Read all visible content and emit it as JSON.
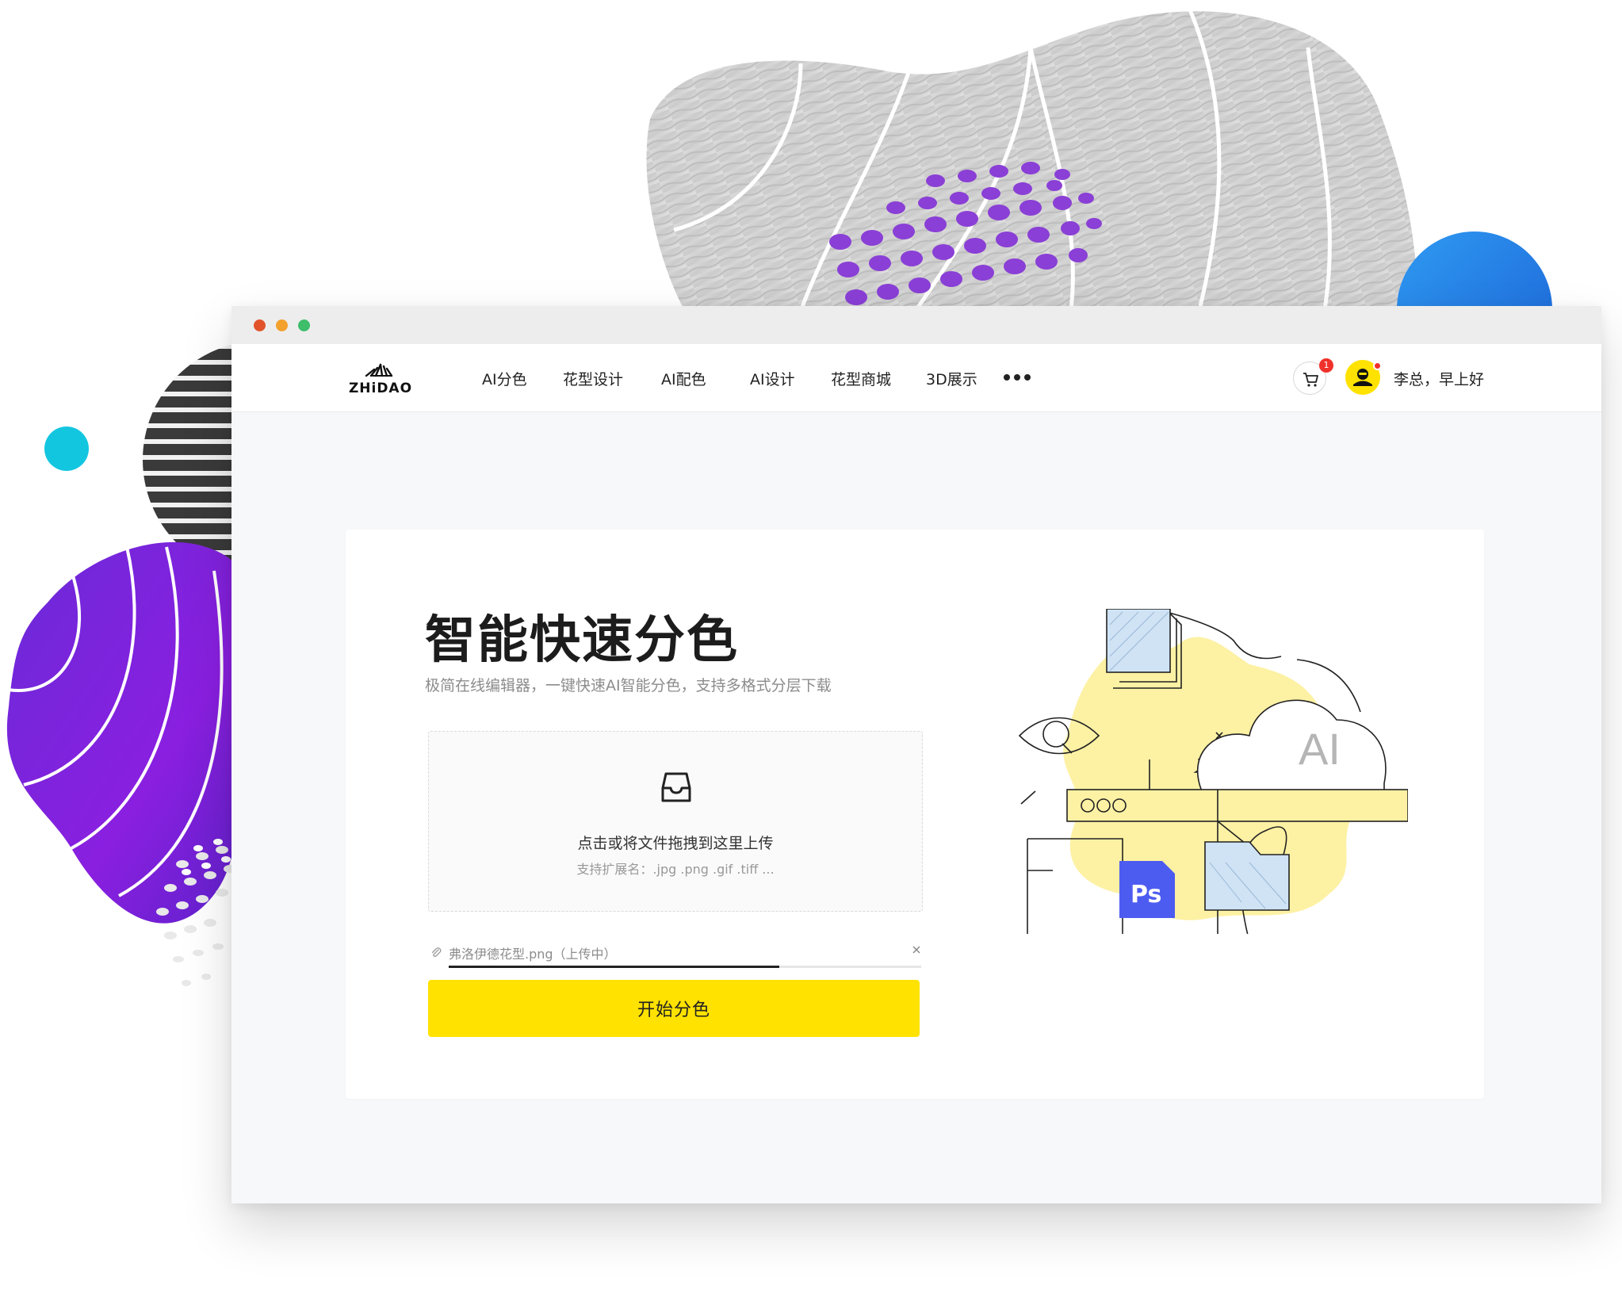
{
  "window": {
    "controls": [
      "close-dot",
      "minimize-dot",
      "maximize-dot"
    ],
    "control_colors": [
      "#e2532b",
      "#f3a02d",
      "#3ebd6a"
    ]
  },
  "navbar": {
    "logo_text": "ZHiDAO",
    "items": [
      {
        "label": "AI分色"
      },
      {
        "label": "花型设计"
      },
      {
        "label": "AI配色"
      },
      {
        "label": "AI设计"
      },
      {
        "label": "花型商城"
      },
      {
        "label": "3D展示"
      }
    ],
    "more_icon": "more-icon",
    "cart_icon": "cart-icon",
    "cart_badge": "1",
    "avatar_icon": "user-icon",
    "greeting": "李总，早上好"
  },
  "hero": {
    "title": "智能快速分色",
    "subtitle": "极简在线编辑器，一键快速AI智能分色，支持多格式分层下载"
  },
  "upload": {
    "icon": "inbox-icon",
    "main_text": "点击或将文件拖拽到这里上传",
    "hint": "支持扩展名：.jpg .png .gif .tiff ..."
  },
  "file": {
    "name": "弗洛伊德花型.png（上传中）",
    "progress": 0.7,
    "remove_icon": "close-icon"
  },
  "actions": {
    "start_label": "开始分色"
  },
  "illustration": {
    "cloud_label": "AI",
    "ps_label": "Ps"
  },
  "colors": {
    "accent": "#ffe200",
    "badge": "#f0312b",
    "purple": "#7d2ad9",
    "blue": "#2d7fe6",
    "cyan": "#13c6e0",
    "ps_blue": "#4d5cf0"
  }
}
